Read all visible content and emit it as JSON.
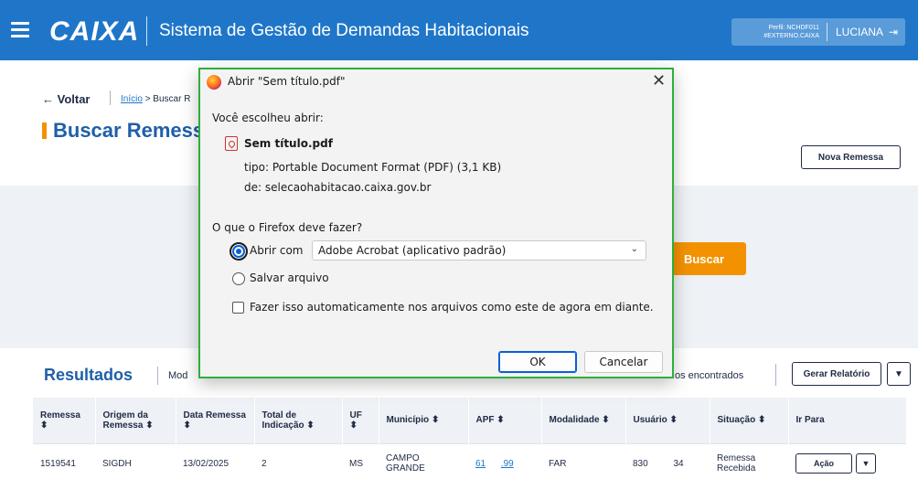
{
  "header": {
    "logo": "CAIXA",
    "app_title": "Sistema de Gestão de Demandas Habitacionais",
    "profile_line1": "Perfil: NCHDF011",
    "profile_line2": "#EXTERNO.CAIXA",
    "user_name": "LUCIANA",
    "logout_icon": "⇥"
  },
  "page": {
    "back_label": "← Voltar",
    "breadcrumb_home": "Início",
    "breadcrumb_current": "> Buscar R",
    "title": "Buscar Remess",
    "new_button": "Nova Remessa",
    "search_button": "Buscar"
  },
  "results": {
    "title": "Resultados",
    "mode_label": "Mod",
    "found_label": "os encontrados",
    "report_button": "Gerar Relatório",
    "report_dropdown": "▼",
    "columns": [
      {
        "label": "Remessa ⬍"
      },
      {
        "label": "Origem da Remessa ⬍"
      },
      {
        "label": "Data Remessa ⬍"
      },
      {
        "label": "Total de Indicação ⬍"
      },
      {
        "label": "UF ⬍"
      },
      {
        "label": "Município ⬍"
      },
      {
        "label": "APF ⬍"
      },
      {
        "label": "Modalidade ⬍"
      },
      {
        "label": "Usuário ⬍"
      },
      {
        "label": "Situação ⬍"
      },
      {
        "label": "Ir Para"
      }
    ],
    "row": {
      "remessa": "1519541",
      "origem": "SIGDH",
      "data": "13/02/2025",
      "total": "2",
      "uf": "MS",
      "municipio": "CAMPO GRANDE",
      "apf_a": "61",
      "apf_b": ".99",
      "modalidade": "FAR",
      "usuario_a": "830",
      "usuario_b": "34",
      "situacao": "Remessa Recebida",
      "action": "Ação",
      "action_dropdown": "▼"
    }
  },
  "dialog": {
    "title": "Abrir \"Sem título.pdf\"",
    "close_icon": "✕",
    "chose_label": "Você escolheu abrir:",
    "file_name": "Sem título.pdf",
    "file_type": "tipo: Portable Document Format (PDF) (3,1 KB)",
    "file_from": "de: selecaohabitacao.caixa.gov.br",
    "question": "O que o Firefox deve fazer?",
    "open_with_label": "Abrir com",
    "app_selected": "Adobe Acrobat (aplicativo padrão)",
    "save_label": "Salvar arquivo",
    "auto_label": "Fazer isso automaticamente nos arquivos como este de agora em diante.",
    "ok": "OK",
    "cancel": "Cancelar"
  },
  "colors": {
    "header_blue": "#1f76c9",
    "accent_orange": "#f39200",
    "dialog_focus_green": "#2fae3c"
  }
}
